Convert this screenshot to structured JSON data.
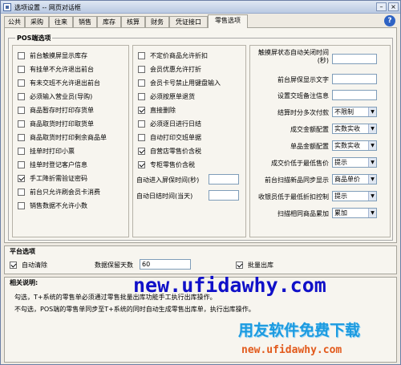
{
  "window": {
    "title": "选项设置 -- 网页对话框"
  },
  "tabs": [
    "公共",
    "采购",
    "往来",
    "销售",
    "库存",
    "核算",
    "财务",
    "凭证接口",
    "零售选项"
  ],
  "pos": {
    "group_label": "POS端选项",
    "col1": [
      {
        "label": "前台触摸屏显示库存",
        "checked": false
      },
      {
        "label": "有挂单不允许退出前台",
        "checked": false
      },
      {
        "label": "有未交班不允许退出前台",
        "checked": false
      },
      {
        "label": "必须输入营业员(导购)",
        "checked": false
      },
      {
        "label": "商品暂存时打印存货单",
        "checked": false
      },
      {
        "label": "商品取货时打印取货单",
        "checked": false
      },
      {
        "label": "商品取货时打印剩余商品单",
        "checked": false
      },
      {
        "label": "挂单时打印小票",
        "checked": false
      },
      {
        "label": "挂单时登记客户信息",
        "checked": false
      },
      {
        "label": "手工降折需验证密码",
        "checked": true
      },
      {
        "label": "前台只允许刷会员卡消费",
        "checked": false
      },
      {
        "label": "销售数据不允许小数",
        "checked": false
      }
    ],
    "col2": [
      {
        "label": "不定价商品允许折扣",
        "checked": false
      },
      {
        "label": "会员优惠允许打折",
        "checked": false
      },
      {
        "label": "会员卡号禁止用键盘输入",
        "checked": false
      },
      {
        "label": "必须按原单退货",
        "checked": false
      },
      {
        "label": "直接删除",
        "checked": true
      },
      {
        "label": "必须逐日进行日结",
        "checked": false
      },
      {
        "label": "自动打印交班单据",
        "checked": false
      },
      {
        "label": "自营店零售价含税",
        "checked": true
      },
      {
        "label": "专柜零售价含税",
        "checked": true
      }
    ],
    "col2_fields": [
      {
        "label": "自动进入屏保时间(秒)",
        "value": ""
      },
      {
        "label": "自动日结时间(当天)",
        "value": ""
      }
    ],
    "col3": {
      "touch_timeout_label": "触摸屏状态自动关闭时间(秒)",
      "touch_timeout_value": "",
      "screensaver_text_label": "前台屏保显示文字",
      "screensaver_text_value": "",
      "shift_note_label": "设置交班备注信息",
      "shift_note_value": "",
      "multi_pay_label": "结算时分多次付款",
      "multi_pay_value": "不限制",
      "amount_config_label": "成交金额配置",
      "amount_config_value": "实数实收",
      "unit_price_config_label": "单品金额配置",
      "unit_price_config_value": "实数实收",
      "below_min_price_label": "成交价低于最低售价",
      "below_min_price_value": "提示",
      "scan_sync_label": "前台扫描新品同步显示",
      "scan_sync_value": "商品单价",
      "cashier_min_discount_label": "收银员低于最低折扣控制",
      "cashier_min_discount_value": "提示",
      "scan_same_label": "扫描相同商品累加",
      "scan_same_value": "累加"
    }
  },
  "platform": {
    "title": "平台选项",
    "auto_clear_label": "自动清除",
    "auto_clear_checked": true,
    "keep_days_label": "数据保留天数",
    "keep_days_value": "60",
    "batch_out_label": "批量出库",
    "batch_out_checked": true
  },
  "explain": {
    "title": "相关说明:",
    "line1": "勾选，T+系统的零售单必须通过零售批量出库功能手工执行出库操作。",
    "line2": "不勾选，POS端的零售单同步至T+系统的同时自动生成零售出库单，执行出库操作。"
  },
  "watermark": {
    "url": "new.ufidawhy.com",
    "slogan": "用友软件免费下载",
    "url2": "new.ufidawhy.com"
  }
}
